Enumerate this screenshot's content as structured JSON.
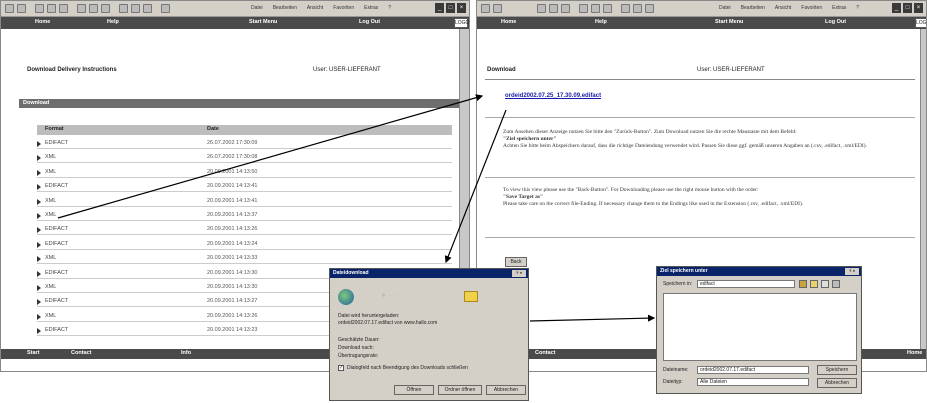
{
  "browser": {
    "menu": [
      "Datei",
      "Bearbeiten",
      "Ansicht",
      "Favoriten",
      "Extras",
      "?"
    ],
    "logo_text": "LOGO"
  },
  "left": {
    "nav": [
      "Home",
      "Help",
      "Start Menu",
      "Log Out"
    ],
    "heading": "Download  Delivery Instructions",
    "user": "User: USER-LIEFERANT",
    "band": "Download",
    "col_format": "Format",
    "col_date": "Date",
    "rows": [
      {
        "format": "EDIFACT",
        "date": "26.07.2002 17:30:09"
      },
      {
        "format": "XML",
        "date": "26.07.2002 17:30:08"
      },
      {
        "format": "XML",
        "date": "20.09.2001 14:13:50"
      },
      {
        "format": "EDIFACT",
        "date": "20.09.2001 14:13:41"
      },
      {
        "format": "XML",
        "date": "20.09.2001 14:13:41"
      },
      {
        "format": "XML",
        "date": "20.09.2001 14:13:37"
      },
      {
        "format": "EDIFACT",
        "date": "20.09.2001 14:13:26"
      },
      {
        "format": "EDIFACT",
        "date": "20.09.2001 14:13:24"
      },
      {
        "format": "XML",
        "date": "20.09.2001 14:13:33"
      },
      {
        "format": "EDIFACT",
        "date": "20.09.2001 14:13:30"
      },
      {
        "format": "XML",
        "date": "20.09.2001 14:13:30"
      },
      {
        "format": "EDIFACT",
        "date": "20.09.2001 14:13:27"
      },
      {
        "format": "XML",
        "date": "20.09.2001 14:13:26"
      },
      {
        "format": "EDIFACT",
        "date": "20.09.2001 14:13:23"
      }
    ],
    "bottom": [
      "Start",
      "Contact",
      "Info"
    ]
  },
  "right": {
    "nav": [
      "Home",
      "Help",
      "Start Menu",
      "Log Out"
    ],
    "heading": "Download",
    "user": "User: USER-LIEFERANT",
    "file_link": "ordeid2002.07.25_17.30.09.edifact",
    "para1": "Zum Ansehen dieser Anzeige nutzen Sie bitte den \"Zurück-Button\". Zum Download nutzen Sie die rechte Maustaste mit dem Befehl:",
    "cmd1": "\"Ziel speichern unter\"",
    "para1b": "Achten Sie bitte beim Abspeichern darauf, dass die richtige Dateiendung verwendet wird. Passen Sie diese ggf. gemäß unseren Angaben an (.csv, .edifact, .xml/EDI).",
    "para2": "To view this view please use the \"Back-Button\". For Downloading please use the right mouse button with the order:",
    "cmd2": "\"Save Target as\"",
    "para2b": "Please take care on the correct file-Ending. If necessary change them to the Endings like used in the Extension (.csv, .edifact, .xml/EDI).",
    "back": "Back",
    "bottom": [
      "Contact",
      "Home"
    ]
  },
  "download_dialog": {
    "title": "Dateidownload",
    "line1": "Datei wird heruntergeladen:",
    "line2": "ordeid2002.07.17.edifact von www.hallo.com",
    "remaining": "Geschätzte Dauer:",
    "target": "Download nach:",
    "rate": "Übertragungsrate:",
    "checkbox": "Dialogfeld nach Beendigung des Downloads schließen",
    "buttons": [
      "Öffnen",
      "Ordner öffnen",
      "Abbrechen"
    ]
  },
  "save_dialog": {
    "title": "Ziel speichern unter",
    "save_in_label": "Speichern in:",
    "save_in": "edifact",
    "filename_label": "Dateiname:",
    "filename": "ordeid2002.07.17.edifact",
    "type_label": "Dateityp:",
    "type": "Alle Dateien",
    "save_btn": "Speichern",
    "cancel_btn": "Abbrechen"
  }
}
